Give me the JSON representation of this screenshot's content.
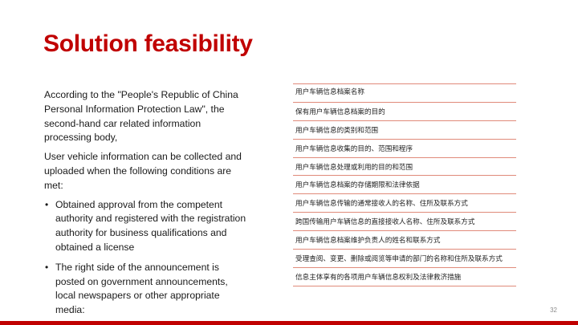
{
  "slide": {
    "title": "Solution feasibility",
    "paragraphs": [
      "According to the \"People's Republic of China Personal Information Protection Law\", the second-hand car related information processing body,",
      "User vehicle information can be collected and uploaded when the following conditions are met:"
    ],
    "bullets": [
      "Obtained approval from the competent authority and registered with the registration authority for business qualifications and obtained a license",
      "The right side of the announcement is posted on government announcements, local newspapers or other appropriate media:"
    ],
    "bullet_glyph": "•",
    "table_rows": [
      "用户车辆信息档案名称",
      "保有用户车辆信息档案的目的",
      "用户车辆信息的类别和范围",
      "用户车辆信息收集的目的、范围和程序",
      "用户车辆信息处理或利用的目的和范围",
      "用户车辆信息档案的存储期限和法律依据",
      "用户车辆信息传输的通常接收人的名称、住所及联系方式",
      "跨国传输用户车辆信息的直接接收人名称、住所及联系方式",
      "用户车辆信息档案维护负责人的姓名和联系方式",
      "受理查阅、变更、删除或阅览等申请的部门的名称和住所及联系方式",
      "信息主体享有的各项用户车辆信息权利及法律救济措施"
    ],
    "page_number": "32"
  },
  "colors": {
    "accent": "#c00000",
    "table_rule": "#e08a7a",
    "text": "#1a1a1a"
  }
}
